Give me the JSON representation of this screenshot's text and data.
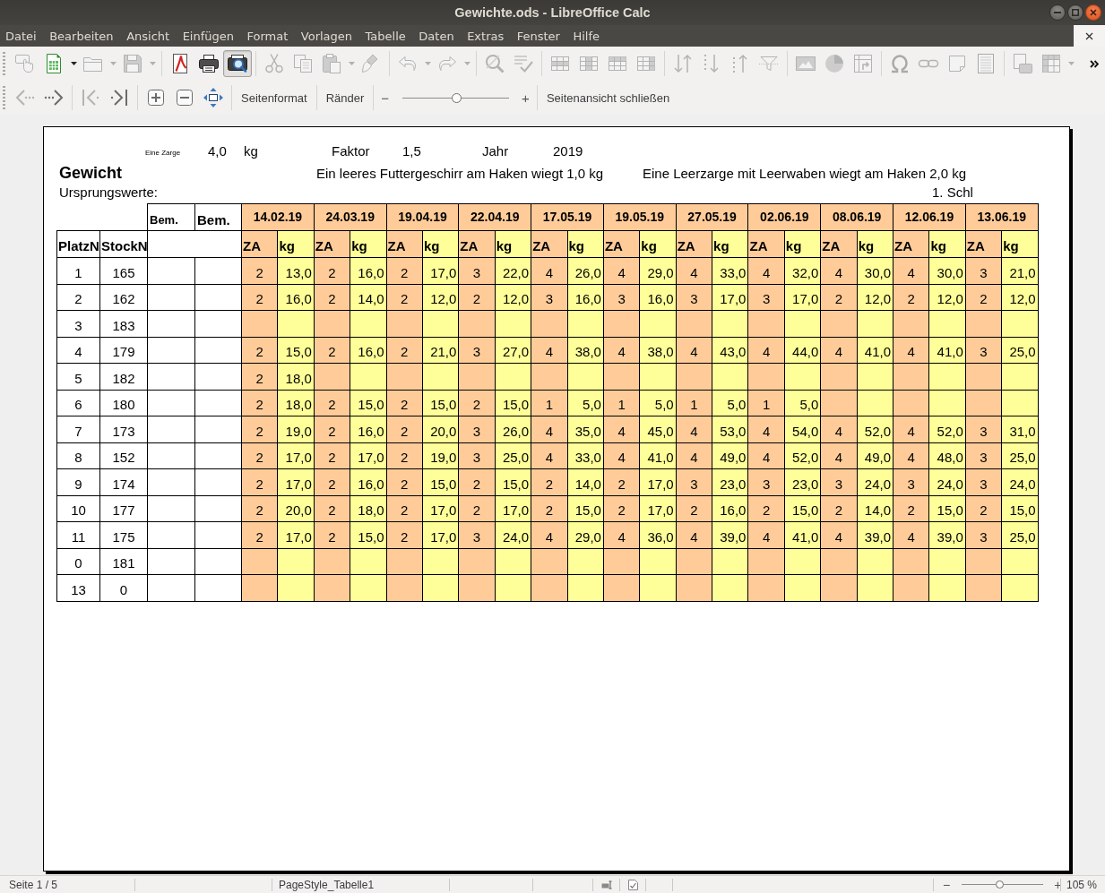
{
  "window": {
    "title": "Gewichte.ods - LibreOffice Calc"
  },
  "menu": [
    "Datei",
    "Bearbeiten",
    "Ansicht",
    "Einfügen",
    "Format",
    "Vorlagen",
    "Tabelle",
    "Daten",
    "Extras",
    "Fenster",
    "Hilfe"
  ],
  "standard_toolbar": [
    [
      {
        "kind": "form",
        "disabled": true,
        "pressed": false
      },
      {
        "kind": "new",
        "disabled": false,
        "pressed": false
      },
      {
        "kind": "caret",
        "disabled": false
      },
      {
        "kind": "open",
        "disabled": true,
        "pressed": false
      },
      {
        "kind": "caret",
        "disabled": true
      },
      {
        "kind": "save",
        "disabled": true,
        "pressed": false
      },
      {
        "kind": "caret",
        "disabled": true
      }
    ],
    [
      {
        "kind": "pdf",
        "disabled": false,
        "pressed": false
      },
      {
        "kind": "print",
        "disabled": false,
        "pressed": false
      },
      {
        "kind": "preview",
        "disabled": false,
        "pressed": true
      }
    ],
    [
      {
        "kind": "cut",
        "disabled": true,
        "pressed": false
      },
      {
        "kind": "copy",
        "disabled": true,
        "pressed": false
      },
      {
        "kind": "paste",
        "disabled": true,
        "pressed": false
      },
      {
        "kind": "caret",
        "disabled": true
      },
      {
        "kind": "clone",
        "disabled": true,
        "pressed": false
      }
    ],
    [
      {
        "kind": "undo",
        "disabled": true,
        "pressed": false
      },
      {
        "kind": "caret",
        "disabled": true
      },
      {
        "kind": "redo",
        "disabled": true,
        "pressed": false
      },
      {
        "kind": "caret",
        "disabled": true
      }
    ],
    [
      {
        "kind": "find",
        "disabled": true,
        "pressed": false
      },
      {
        "kind": "spell",
        "disabled": true,
        "pressed": false
      }
    ],
    [
      {
        "kind": "rowabove",
        "disabled": true,
        "pressed": false
      },
      {
        "kind": "colbefore",
        "disabled": true,
        "pressed": false
      },
      {
        "kind": "delrow",
        "disabled": true,
        "pressed": false
      },
      {
        "kind": "delcol",
        "disabled": true,
        "pressed": false
      }
    ],
    [
      {
        "kind": "sortboth",
        "disabled": true,
        "pressed": false
      },
      {
        "kind": "sortdesc",
        "disabled": true,
        "pressed": false
      },
      {
        "kind": "sortasc",
        "disabled": true,
        "pressed": false
      },
      {
        "kind": "filter",
        "disabled": true,
        "pressed": false
      }
    ],
    [
      {
        "kind": "image",
        "disabled": true,
        "pressed": false
      },
      {
        "kind": "chart",
        "disabled": true,
        "pressed": false
      },
      {
        "kind": "pivot",
        "disabled": true,
        "pressed": false
      }
    ],
    [
      {
        "kind": "symbol",
        "disabled": true,
        "pressed": false
      },
      {
        "kind": "link",
        "disabled": true,
        "pressed": false
      },
      {
        "kind": "note",
        "disabled": true,
        "pressed": false
      },
      {
        "kind": "headerfooter",
        "disabled": true,
        "pressed": false
      }
    ],
    [
      {
        "kind": "printarea",
        "disabled": true,
        "pressed": false
      },
      {
        "kind": "freeze",
        "disabled": true,
        "pressed": false
      },
      {
        "kind": "caret",
        "disabled": true
      },
      {
        "kind": "more",
        "disabled": false,
        "pressed": false
      }
    ]
  ],
  "preview_toolbar": {
    "icon_groups": [
      [
        {
          "kind": "previous",
          "disabled": true
        },
        {
          "kind": "next",
          "disabled": false
        }
      ],
      [
        {
          "kind": "first",
          "disabled": true
        },
        {
          "kind": "last",
          "disabled": false
        }
      ],
      [
        {
          "kind": "zoomin",
          "disabled": false
        },
        {
          "kind": "zoomout",
          "disabled": false
        },
        {
          "kind": "fullscreen",
          "disabled": false
        }
      ]
    ],
    "text_buttons": [
      "Seitenformat",
      "Ränder"
    ],
    "zoom": {
      "minus": "−",
      "plus": "+",
      "level": 0.51
    },
    "close_label": "Seitenansicht schließen"
  },
  "sheet": {
    "zarge_label": "Eine Zarge",
    "zarge_value": "4,0",
    "zarge_unit": "kg",
    "faktor_label": "Faktor",
    "faktor_value": "1,5",
    "jahr_label": "Jahr",
    "jahr_value": "2019",
    "title": "Gewicht",
    "note_futtergeschirr": "Ein leeres Futtergeschirr am Haken wiegt 1,0 kg",
    "note_leerzarge": "Eine Leerzarge mit Leerwaben wiegt am Haken 2,0 kg",
    "subtitle": "Ursprungswerte:",
    "label_schl": "1. Schl"
  },
  "table": {
    "id_headers": [
      "PlatzN",
      "StockN"
    ],
    "remark_headers": [
      "Bem.",
      "Bem."
    ],
    "dates": [
      {
        "date": "14.02.19",
        "columns": [
          "ZA",
          "kg"
        ]
      },
      {
        "date": "24.03.19",
        "columns": [
          "ZA",
          "kg"
        ]
      },
      {
        "date": "19.04.19",
        "columns": [
          "ZA",
          "kg"
        ]
      },
      {
        "date": "22.04.19",
        "columns": [
          "ZA",
          "kg"
        ]
      },
      {
        "date": "17.05.19",
        "columns": [
          "ZA",
          "kg"
        ]
      },
      {
        "date": "19.05.19",
        "columns": [
          "ZA",
          "kg"
        ]
      },
      {
        "date": "27.05.19",
        "columns": [
          "ZA",
          "kg"
        ]
      },
      {
        "date": "02.06.19",
        "columns": [
          "ZA",
          "kg"
        ]
      },
      {
        "date": "08.06.19",
        "columns": [
          "ZA",
          "kg"
        ]
      },
      {
        "date": "12.06.19",
        "columns": [
          "ZA",
          "kg"
        ]
      },
      {
        "date": "13.06.19",
        "columns": [
          "ZA",
          "kg"
        ]
      }
    ],
    "rows": [
      {
        "platz": "1",
        "stock": "165",
        "readings": [
          {
            "za": "2",
            "kg": "13,0"
          },
          {
            "za": "2",
            "kg": "16,0"
          },
          {
            "za": "2",
            "kg": "17,0"
          },
          {
            "za": "3",
            "kg": "22,0"
          },
          {
            "za": "4",
            "kg": "26,0"
          },
          {
            "za": "4",
            "kg": "29,0"
          },
          {
            "za": "4",
            "kg": "33,0"
          },
          {
            "za": "4",
            "kg": "32,0"
          },
          {
            "za": "4",
            "kg": "30,0"
          },
          {
            "za": "4",
            "kg": "30,0"
          },
          {
            "za": "3",
            "kg": "21,0"
          }
        ]
      },
      {
        "platz": "2",
        "stock": "162",
        "readings": [
          {
            "za": "2",
            "kg": "16,0"
          },
          {
            "za": "2",
            "kg": "14,0"
          },
          {
            "za": "2",
            "kg": "12,0"
          },
          {
            "za": "2",
            "kg": "12,0"
          },
          {
            "za": "3",
            "kg": "16,0"
          },
          {
            "za": "3",
            "kg": "16,0"
          },
          {
            "za": "3",
            "kg": "17,0"
          },
          {
            "za": "3",
            "kg": "17,0"
          },
          {
            "za": "2",
            "kg": "12,0"
          },
          {
            "za": "2",
            "kg": "12,0"
          },
          {
            "za": "2",
            "kg": "12,0"
          }
        ]
      },
      {
        "platz": "3",
        "stock": "183",
        "readings": []
      },
      {
        "platz": "4",
        "stock": "179",
        "readings": [
          {
            "za": "2",
            "kg": "15,0"
          },
          {
            "za": "2",
            "kg": "16,0"
          },
          {
            "za": "2",
            "kg": "21,0"
          },
          {
            "za": "3",
            "kg": "27,0"
          },
          {
            "za": "4",
            "kg": "38,0"
          },
          {
            "za": "4",
            "kg": "38,0"
          },
          {
            "za": "4",
            "kg": "43,0"
          },
          {
            "za": "4",
            "kg": "44,0"
          },
          {
            "za": "4",
            "kg": "41,0"
          },
          {
            "za": "4",
            "kg": "41,0"
          },
          {
            "za": "3",
            "kg": "25,0"
          }
        ]
      },
      {
        "platz": "5",
        "stock": "182",
        "readings": [
          {
            "za": "2",
            "kg": "18,0"
          }
        ]
      },
      {
        "platz": "6",
        "stock": "180",
        "readings": [
          {
            "za": "2",
            "kg": "18,0"
          },
          {
            "za": "2",
            "kg": "15,0"
          },
          {
            "za": "2",
            "kg": "15,0"
          },
          {
            "za": "2",
            "kg": "15,0"
          },
          {
            "za": "1",
            "kg": "5,0"
          },
          {
            "za": "1",
            "kg": "5,0"
          },
          {
            "za": "1",
            "kg": "5,0"
          },
          {
            "za": "1",
            "kg": "5,0"
          }
        ]
      },
      {
        "platz": "7",
        "stock": "173",
        "readings": [
          {
            "za": "2",
            "kg": "19,0"
          },
          {
            "za": "2",
            "kg": "16,0"
          },
          {
            "za": "2",
            "kg": "20,0"
          },
          {
            "za": "3",
            "kg": "26,0"
          },
          {
            "za": "4",
            "kg": "35,0"
          },
          {
            "za": "4",
            "kg": "45,0"
          },
          {
            "za": "4",
            "kg": "53,0"
          },
          {
            "za": "4",
            "kg": "54,0"
          },
          {
            "za": "4",
            "kg": "52,0"
          },
          {
            "za": "4",
            "kg": "52,0"
          },
          {
            "za": "3",
            "kg": "31,0"
          }
        ]
      },
      {
        "platz": "8",
        "stock": "152",
        "readings": [
          {
            "za": "2",
            "kg": "17,0"
          },
          {
            "za": "2",
            "kg": "17,0"
          },
          {
            "za": "2",
            "kg": "19,0"
          },
          {
            "za": "3",
            "kg": "25,0"
          },
          {
            "za": "4",
            "kg": "33,0"
          },
          {
            "za": "4",
            "kg": "41,0"
          },
          {
            "za": "4",
            "kg": "49,0"
          },
          {
            "za": "4",
            "kg": "52,0"
          },
          {
            "za": "4",
            "kg": "49,0"
          },
          {
            "za": "4",
            "kg": "48,0"
          },
          {
            "za": "3",
            "kg": "25,0"
          }
        ]
      },
      {
        "platz": "9",
        "stock": "174",
        "readings": [
          {
            "za": "2",
            "kg": "17,0"
          },
          {
            "za": "2",
            "kg": "16,0"
          },
          {
            "za": "2",
            "kg": "15,0"
          },
          {
            "za": "2",
            "kg": "15,0"
          },
          {
            "za": "2",
            "kg": "14,0"
          },
          {
            "za": "2",
            "kg": "17,0"
          },
          {
            "za": "3",
            "kg": "23,0"
          },
          {
            "za": "3",
            "kg": "23,0"
          },
          {
            "za": "3",
            "kg": "24,0"
          },
          {
            "za": "3",
            "kg": "24,0"
          },
          {
            "za": "3",
            "kg": "24,0"
          }
        ]
      },
      {
        "platz": "10",
        "stock": "177",
        "readings": [
          {
            "za": "2",
            "kg": "20,0"
          },
          {
            "za": "2",
            "kg": "18,0"
          },
          {
            "za": "2",
            "kg": "17,0"
          },
          {
            "za": "2",
            "kg": "17,0"
          },
          {
            "za": "2",
            "kg": "15,0"
          },
          {
            "za": "2",
            "kg": "17,0"
          },
          {
            "za": "2",
            "kg": "16,0"
          },
          {
            "za": "2",
            "kg": "15,0"
          },
          {
            "za": "2",
            "kg": "14,0"
          },
          {
            "za": "2",
            "kg": "15,0"
          },
          {
            "za": "2",
            "kg": "15,0"
          }
        ]
      },
      {
        "platz": "11",
        "stock": "175",
        "readings": [
          {
            "za": "2",
            "kg": "17,0"
          },
          {
            "za": "2",
            "kg": "15,0"
          },
          {
            "za": "2",
            "kg": "17,0"
          },
          {
            "za": "3",
            "kg": "24,0"
          },
          {
            "za": "4",
            "kg": "29,0"
          },
          {
            "za": "4",
            "kg": "36,0"
          },
          {
            "za": "4",
            "kg": "39,0"
          },
          {
            "za": "4",
            "kg": "41,0"
          },
          {
            "za": "4",
            "kg": "39,0"
          },
          {
            "za": "4",
            "kg": "39,0"
          },
          {
            "za": "3",
            "kg": "25,0"
          }
        ]
      },
      {
        "platz": "0",
        "stock": "181",
        "readings": []
      },
      {
        "platz": "13",
        "stock": "0",
        "readings": []
      }
    ]
  },
  "status_bar": {
    "page": "Seite 1 / 5",
    "page_style": "PageStyle_Tabelle1",
    "zoom": {
      "minus": "−",
      "plus": "+",
      "level": 0.47,
      "percent": "105 %"
    }
  }
}
